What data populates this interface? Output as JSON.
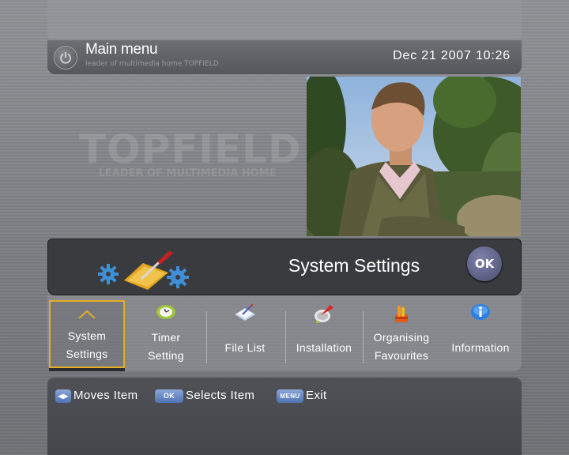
{
  "background": {
    "watermark": "TOPFIELD",
    "watermark_tagline": "LEADER OF MULTIMEDIA HOME"
  },
  "header": {
    "title": "Main menu",
    "subtitle": "leader of multimedia home TOPFIELD",
    "datetime": "Dec 21 2007 10:26",
    "icon": "power-icon"
  },
  "selection": {
    "title": "System Settings",
    "ok_label": "OK",
    "icon": "system-settings-icon"
  },
  "menu": {
    "items": [
      {
        "line1": "System",
        "line2": "Settings",
        "icon": "chevron-up-icon"
      },
      {
        "line1": "Timer",
        "line2": "Setting",
        "icon": "clock-icon"
      },
      {
        "line1": "File List",
        "icon": "file-list-icon"
      },
      {
        "line1": "Installation",
        "icon": "satellite-dish-icon"
      },
      {
        "line1": "Organising",
        "line2": "Favourites",
        "icon": "favourites-icon"
      },
      {
        "line1": "Information",
        "icon": "info-icon"
      }
    ],
    "selected_index": 0
  },
  "footer": {
    "move_key": "◀▶",
    "move_label": "Moves Item",
    "ok_key": "OK",
    "ok_label": "Selects Item",
    "menu_key": "MENU",
    "menu_label": "Exit"
  },
  "colors": {
    "selection_border": "#e4ac27",
    "ok_button": "#5a5e86",
    "key_blue": "#5b7dbf"
  }
}
